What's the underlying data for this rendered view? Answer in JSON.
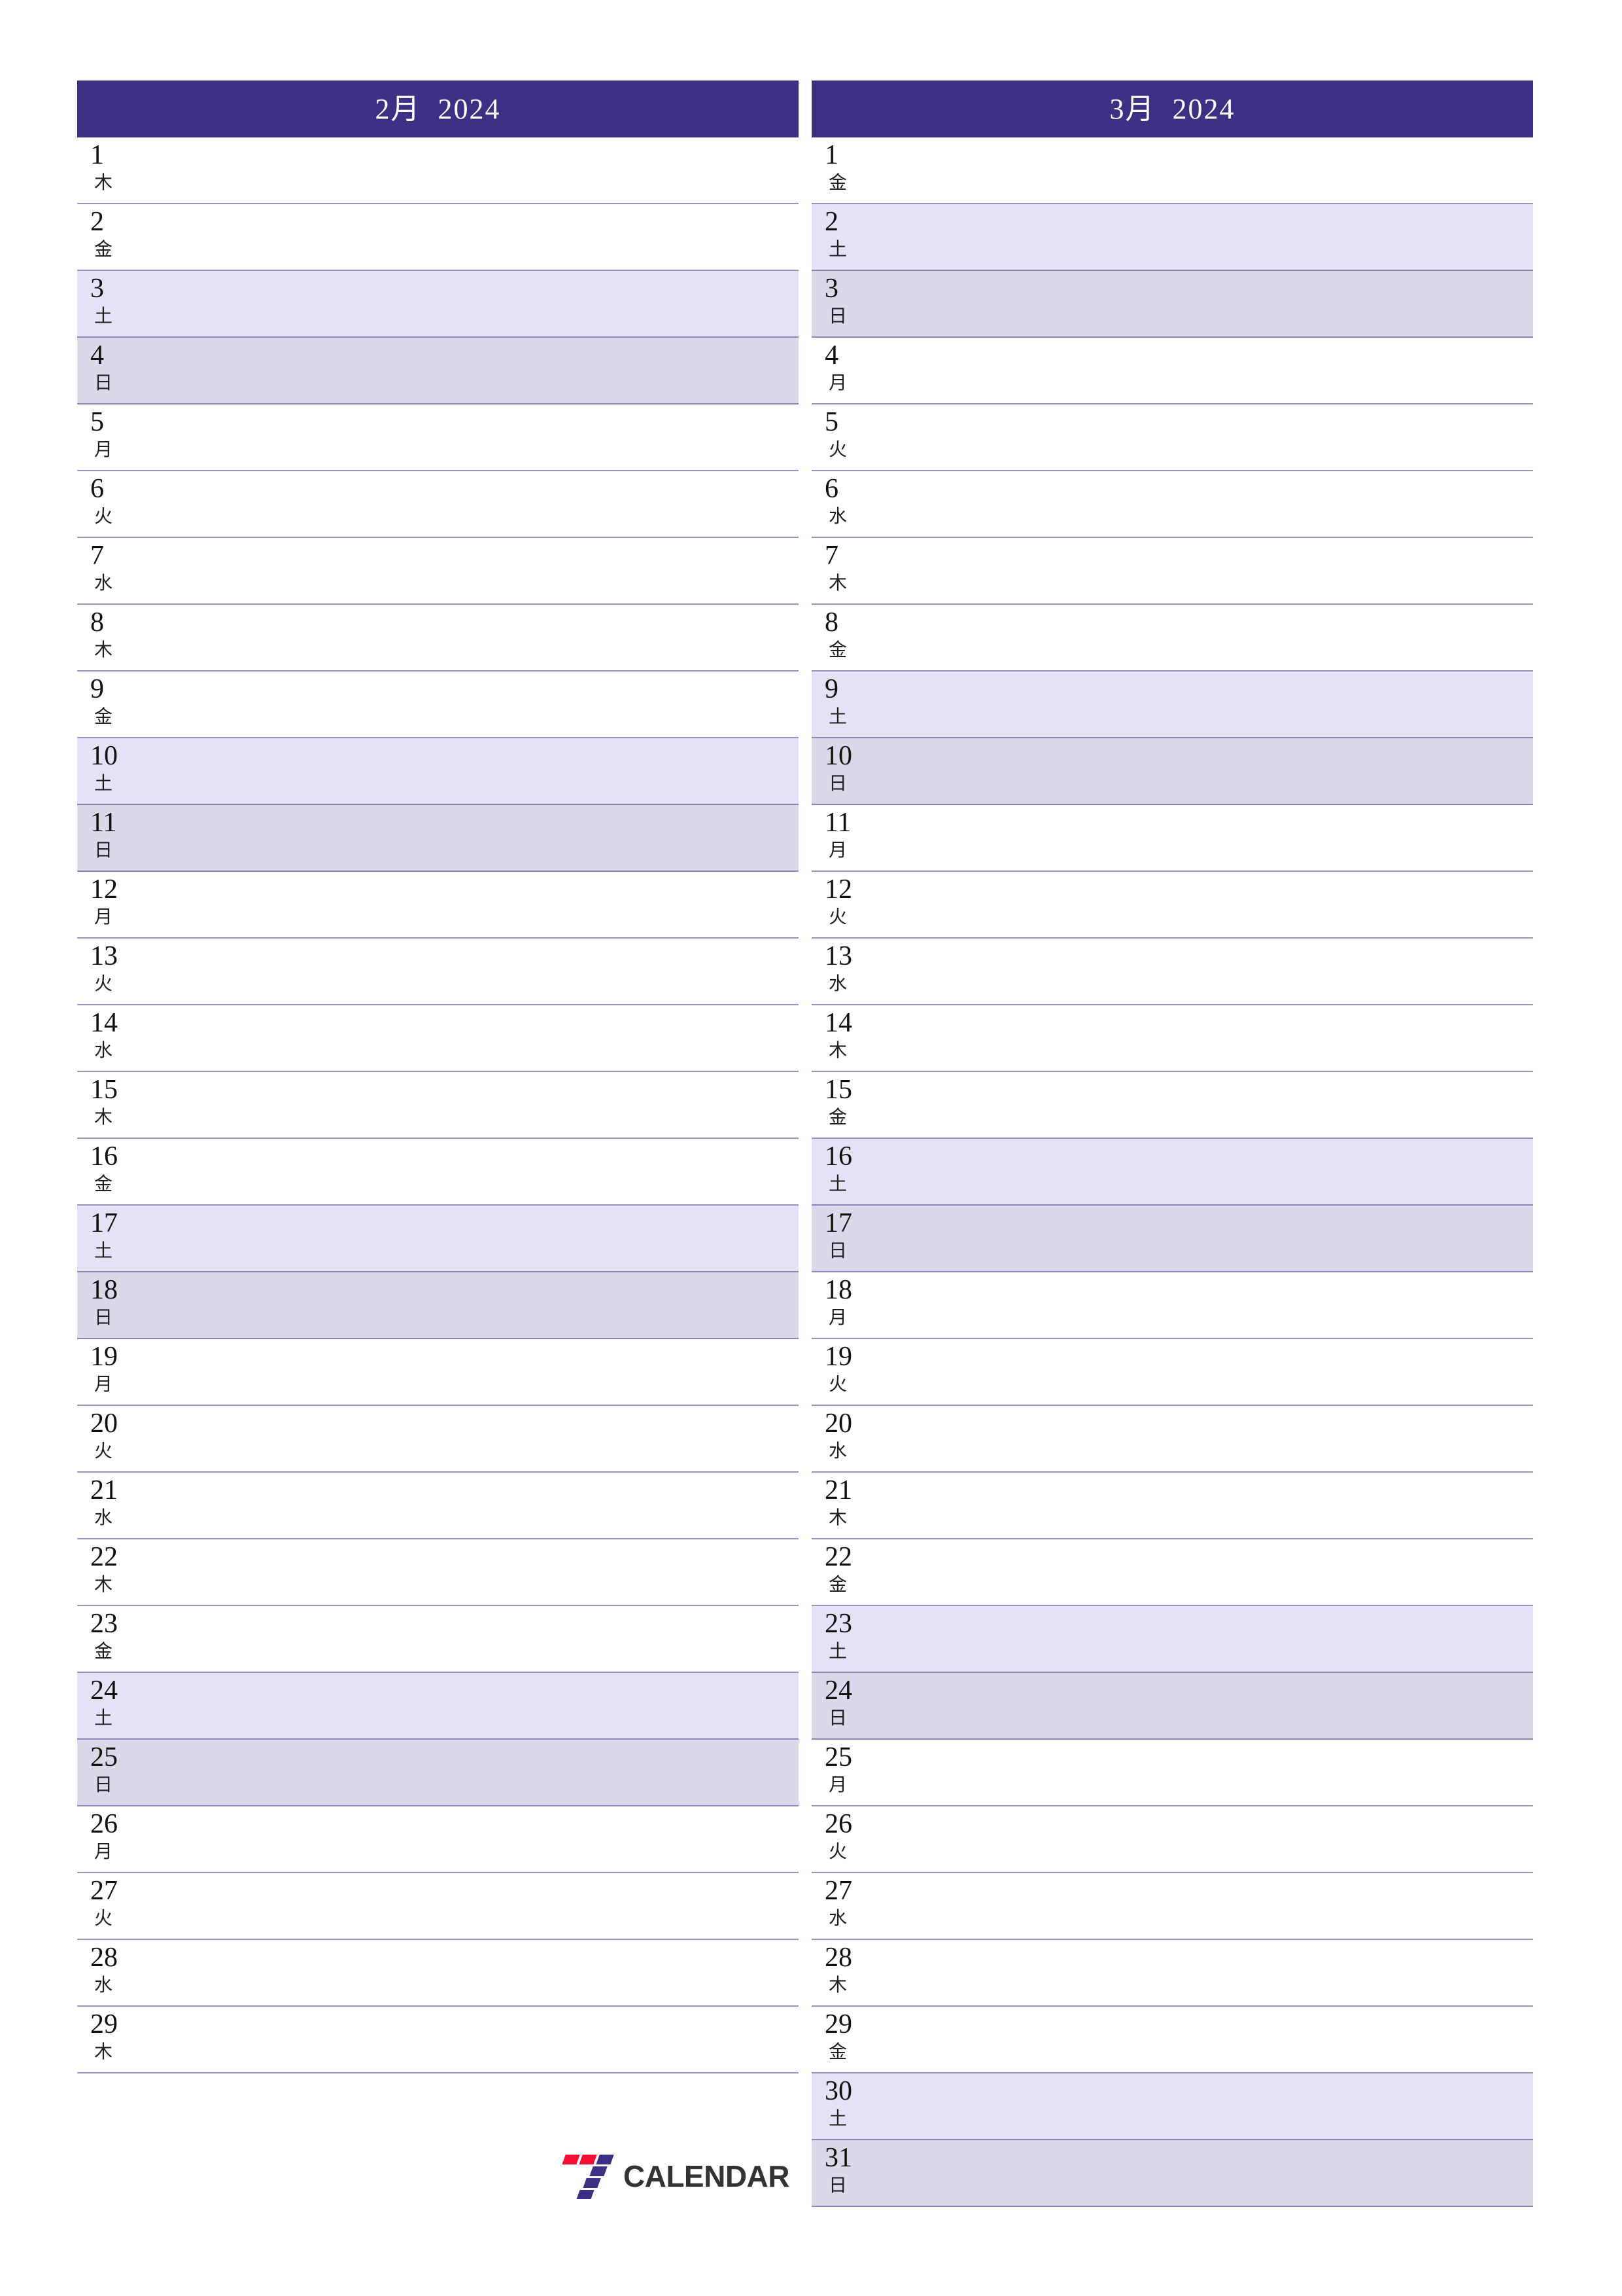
{
  "document": {
    "type": "printable-monthly-planner",
    "year": "2024",
    "locale": "ja"
  },
  "colors": {
    "header_background": "#3a3185",
    "header_text": "#ffffff",
    "saturday_row": "#e2e3f6",
    "sunday_row": "#dbd8ea",
    "row_border": "#9a93bd",
    "page_background": "#ffffff",
    "logo_red": "#f60f35",
    "logo_blue": "#3a3185",
    "logo_text": "#333333"
  },
  "brand": {
    "mark_name": "seven-calendar-logo",
    "text": "CALENDAR"
  },
  "months": [
    {
      "title": "2月  2024",
      "month_label": "2月",
      "year_label": "2024",
      "days": [
        {
          "num": "1",
          "dow": "木",
          "kind": "weekday"
        },
        {
          "num": "2",
          "dow": "金",
          "kind": "weekday"
        },
        {
          "num": "3",
          "dow": "土",
          "kind": "sat"
        },
        {
          "num": "4",
          "dow": "日",
          "kind": "sun"
        },
        {
          "num": "5",
          "dow": "月",
          "kind": "weekday"
        },
        {
          "num": "6",
          "dow": "火",
          "kind": "weekday"
        },
        {
          "num": "7",
          "dow": "水",
          "kind": "weekday"
        },
        {
          "num": "8",
          "dow": "木",
          "kind": "weekday"
        },
        {
          "num": "9",
          "dow": "金",
          "kind": "weekday"
        },
        {
          "num": "10",
          "dow": "土",
          "kind": "sat"
        },
        {
          "num": "11",
          "dow": "日",
          "kind": "sun"
        },
        {
          "num": "12",
          "dow": "月",
          "kind": "weekday"
        },
        {
          "num": "13",
          "dow": "火",
          "kind": "weekday"
        },
        {
          "num": "14",
          "dow": "水",
          "kind": "weekday"
        },
        {
          "num": "15",
          "dow": "木",
          "kind": "weekday"
        },
        {
          "num": "16",
          "dow": "金",
          "kind": "weekday"
        },
        {
          "num": "17",
          "dow": "土",
          "kind": "sat"
        },
        {
          "num": "18",
          "dow": "日",
          "kind": "sun"
        },
        {
          "num": "19",
          "dow": "月",
          "kind": "weekday"
        },
        {
          "num": "20",
          "dow": "火",
          "kind": "weekday"
        },
        {
          "num": "21",
          "dow": "水",
          "kind": "weekday"
        },
        {
          "num": "22",
          "dow": "木",
          "kind": "weekday"
        },
        {
          "num": "23",
          "dow": "金",
          "kind": "weekday"
        },
        {
          "num": "24",
          "dow": "土",
          "kind": "sat"
        },
        {
          "num": "25",
          "dow": "日",
          "kind": "sun"
        },
        {
          "num": "26",
          "dow": "月",
          "kind": "weekday"
        },
        {
          "num": "27",
          "dow": "火",
          "kind": "weekday"
        },
        {
          "num": "28",
          "dow": "水",
          "kind": "weekday"
        },
        {
          "num": "29",
          "dow": "木",
          "kind": "weekday"
        }
      ]
    },
    {
      "title": "3月  2024",
      "month_label": "3月",
      "year_label": "2024",
      "days": [
        {
          "num": "1",
          "dow": "金",
          "kind": "weekday"
        },
        {
          "num": "2",
          "dow": "土",
          "kind": "sat"
        },
        {
          "num": "3",
          "dow": "日",
          "kind": "sun"
        },
        {
          "num": "4",
          "dow": "月",
          "kind": "weekday"
        },
        {
          "num": "5",
          "dow": "火",
          "kind": "weekday"
        },
        {
          "num": "6",
          "dow": "水",
          "kind": "weekday"
        },
        {
          "num": "7",
          "dow": "木",
          "kind": "weekday"
        },
        {
          "num": "8",
          "dow": "金",
          "kind": "weekday"
        },
        {
          "num": "9",
          "dow": "土",
          "kind": "sat"
        },
        {
          "num": "10",
          "dow": "日",
          "kind": "sun"
        },
        {
          "num": "11",
          "dow": "月",
          "kind": "weekday"
        },
        {
          "num": "12",
          "dow": "火",
          "kind": "weekday"
        },
        {
          "num": "13",
          "dow": "水",
          "kind": "weekday"
        },
        {
          "num": "14",
          "dow": "木",
          "kind": "weekday"
        },
        {
          "num": "15",
          "dow": "金",
          "kind": "weekday"
        },
        {
          "num": "16",
          "dow": "土",
          "kind": "sat"
        },
        {
          "num": "17",
          "dow": "日",
          "kind": "sun"
        },
        {
          "num": "18",
          "dow": "月",
          "kind": "weekday"
        },
        {
          "num": "19",
          "dow": "火",
          "kind": "weekday"
        },
        {
          "num": "20",
          "dow": "水",
          "kind": "weekday"
        },
        {
          "num": "21",
          "dow": "木",
          "kind": "weekday"
        },
        {
          "num": "22",
          "dow": "金",
          "kind": "weekday"
        },
        {
          "num": "23",
          "dow": "土",
          "kind": "sat"
        },
        {
          "num": "24",
          "dow": "日",
          "kind": "sun"
        },
        {
          "num": "25",
          "dow": "月",
          "kind": "weekday"
        },
        {
          "num": "26",
          "dow": "火",
          "kind": "weekday"
        },
        {
          "num": "27",
          "dow": "水",
          "kind": "weekday"
        },
        {
          "num": "28",
          "dow": "木",
          "kind": "weekday"
        },
        {
          "num": "29",
          "dow": "金",
          "kind": "weekday"
        },
        {
          "num": "30",
          "dow": "土",
          "kind": "sat"
        },
        {
          "num": "31",
          "dow": "日",
          "kind": "sun"
        }
      ]
    }
  ]
}
